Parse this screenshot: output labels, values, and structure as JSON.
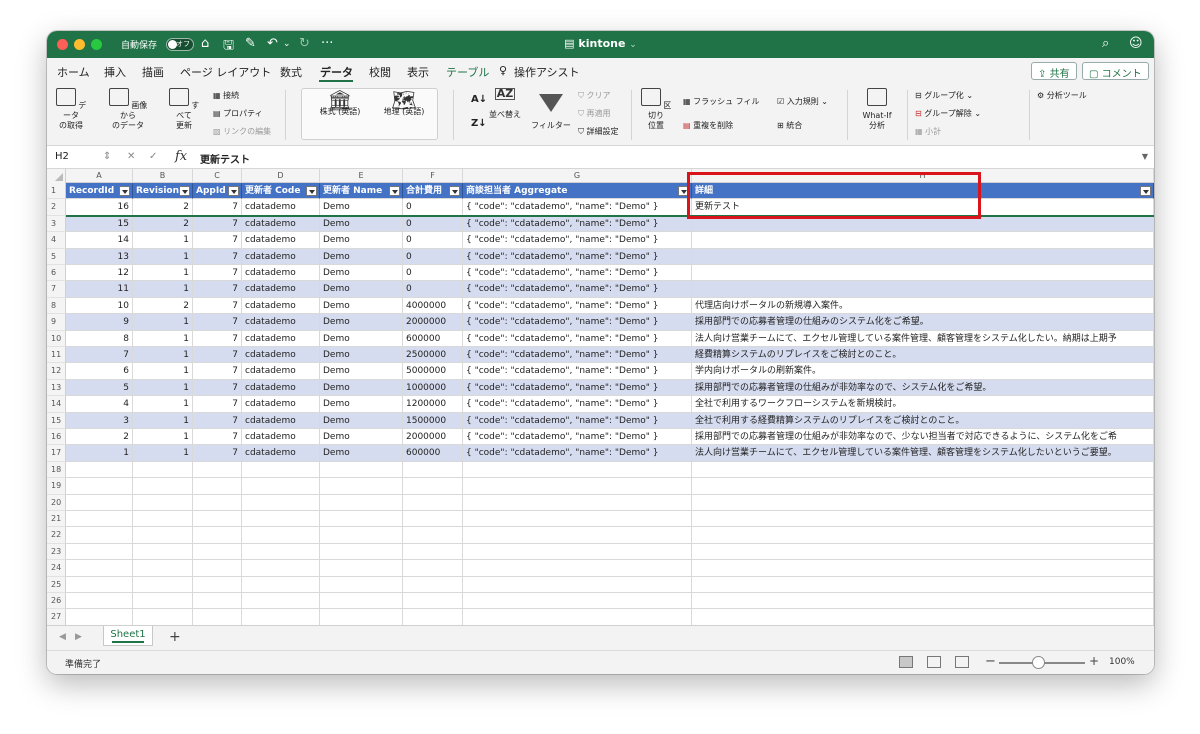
{
  "titlebar": {
    "autosave_label": "自動保存",
    "autosave_state": "オフ",
    "title": "kintone",
    "title_chevron": "⌄",
    "home_icon": "⌂",
    "save_icon": "🖫",
    "edit_icon": "✎",
    "undo_icon": "↶",
    "undo_menu_icon": "⌄",
    "redo_icon": "↻",
    "more_icon": "···",
    "file_icon": "▤",
    "search_icon": "⌕",
    "collab_icon": "☺"
  },
  "menu": {
    "items": [
      "ホーム",
      "挿入",
      "描画",
      "ページ レイアウト",
      "数式",
      "データ",
      "校閲",
      "表示",
      "テーブル",
      "操作アシスト"
    ],
    "tell_me_icon": "♀",
    "share_label": "共有",
    "comment_label": "コメント"
  },
  "ribbon": {
    "get_data": "データ\nの取得",
    "from_picture": "画像から\nのデータ",
    "refresh_all": "すべて\n更新",
    "connections": "接続",
    "properties": "プロパティ",
    "edit_links": "リンクの編集",
    "stocks": "株式 (英語)",
    "geography": "地理 (英語)",
    "sort_az_icon": "A↓",
    "sort_za_icon": "Z↓",
    "sort_icon": "AZ",
    "sort": "並べ替え",
    "filter": "フィルター",
    "clear": "クリア",
    "reapply": "再適用",
    "advanced": "詳細設定",
    "text_to_columns": "区切り\n位置",
    "flash_fill": "フラッシュ フィル",
    "remove_duplicates": "重複を削除",
    "data_validation": "入力規則",
    "consolidate": "統合",
    "what_if": "What-If\n分析",
    "group": "グループ化",
    "ungroup": "グループ解除",
    "subtotal": "小計",
    "analysis_tools": "分析ツール"
  },
  "formula_bar": {
    "name_box": "H2",
    "value": "更新テスト"
  },
  "columns": [
    "A",
    "B",
    "C",
    "D",
    "E",
    "F",
    "G",
    "H"
  ],
  "headers": [
    "RecordId",
    "Revision",
    "AppId",
    "更新者 Code",
    "更新者 Name",
    "合計費用",
    "商談担当者 Aggregate",
    "詳細"
  ],
  "rows": [
    [
      "16",
      "2",
      "7",
      "cdatademo",
      "Demo",
      "0",
      "{   \"code\": \"cdatademo\",   \"name\": \"Demo\"  }",
      "更新テスト"
    ],
    [
      "15",
      "2",
      "7",
      "cdatademo",
      "Demo",
      "0",
      "{   \"code\": \"cdatademo\",   \"name\": \"Demo\"  }",
      ""
    ],
    [
      "14",
      "1",
      "7",
      "cdatademo",
      "Demo",
      "0",
      "{   \"code\": \"cdatademo\",   \"name\": \"Demo\"  }",
      ""
    ],
    [
      "13",
      "1",
      "7",
      "cdatademo",
      "Demo",
      "0",
      "{   \"code\": \"cdatademo\",   \"name\": \"Demo\"  }",
      ""
    ],
    [
      "12",
      "1",
      "7",
      "cdatademo",
      "Demo",
      "0",
      "{   \"code\": \"cdatademo\",   \"name\": \"Demo\"  }",
      ""
    ],
    [
      "11",
      "1",
      "7",
      "cdatademo",
      "Demo",
      "0",
      "{   \"code\": \"cdatademo\",   \"name\": \"Demo\"  }",
      ""
    ],
    [
      "10",
      "2",
      "7",
      "cdatademo",
      "Demo",
      "4000000",
      "{   \"code\": \"cdatademo\",   \"name\": \"Demo\"  }",
      "代理店向けポータルの新規導入案件。"
    ],
    [
      "9",
      "1",
      "7",
      "cdatademo",
      "Demo",
      "2000000",
      "{   \"code\": \"cdatademo\",   \"name\": \"Demo\"  }",
      "採用部門での応募者管理の仕組みのシステム化をご希望。"
    ],
    [
      "8",
      "1",
      "7",
      "cdatademo",
      "Demo",
      "600000",
      "{   \"code\": \"cdatademo\",   \"name\": \"Demo\"  }",
      "法人向け営業チームにて、エクセル管理している案件管理、顧客管理をシステム化したい。納期は上期予"
    ],
    [
      "7",
      "1",
      "7",
      "cdatademo",
      "Demo",
      "2500000",
      "{   \"code\": \"cdatademo\",   \"name\": \"Demo\"  }",
      "経費精算システムのリプレイスをご検討とのこと。"
    ],
    [
      "6",
      "1",
      "7",
      "cdatademo",
      "Demo",
      "5000000",
      "{   \"code\": \"cdatademo\",   \"name\": \"Demo\"  }",
      "学内向けポータルの刷新案件。"
    ],
    [
      "5",
      "1",
      "7",
      "cdatademo",
      "Demo",
      "1000000",
      "{   \"code\": \"cdatademo\",   \"name\": \"Demo\"  }",
      "採用部門での応募者管理の仕組みが非効率なので、システム化をご希望。"
    ],
    [
      "4",
      "1",
      "7",
      "cdatademo",
      "Demo",
      "1200000",
      "{   \"code\": \"cdatademo\",   \"name\": \"Demo\"  }",
      "全社で利用するワークフローシステムを新規検討。"
    ],
    [
      "3",
      "1",
      "7",
      "cdatademo",
      "Demo",
      "1500000",
      "{   \"code\": \"cdatademo\",   \"name\": \"Demo\"  }",
      "全社で利用する経費精算システムのリプレイスをご検討とのこと。"
    ],
    [
      "2",
      "1",
      "7",
      "cdatademo",
      "Demo",
      "2000000",
      "{   \"code\": \"cdatademo\",   \"name\": \"Demo\"  }",
      "採用部門での応募者管理の仕組みが非効率なので、少ない担当者で対応できるように、システム化をご希"
    ],
    [
      "1",
      "1",
      "7",
      "cdatademo",
      "Demo",
      "600000",
      "{   \"code\": \"cdatademo\",   \"name\": \"Demo\"  }",
      "法人向け営業チームにて、エクセル管理している案件管理、顧客管理をシステム化したいというご要望。"
    ]
  ],
  "row_numbers": [
    "1",
    "2",
    "3",
    "4",
    "5",
    "6",
    "7",
    "8",
    "9",
    "10",
    "11",
    "12",
    "13",
    "14",
    "15",
    "16",
    "17",
    "18",
    "19",
    "20",
    "21",
    "22",
    "23",
    "24",
    "25",
    "26",
    "27"
  ],
  "sheet_tab": "Sheet1",
  "add_sheet": "+",
  "status": {
    "text": "準備完了",
    "zoom": "100%"
  },
  "colors": {
    "excel_green": "#1f7346",
    "table_header": "#4472c4",
    "band": "#d6dcef",
    "highlight": "#d9141b"
  }
}
